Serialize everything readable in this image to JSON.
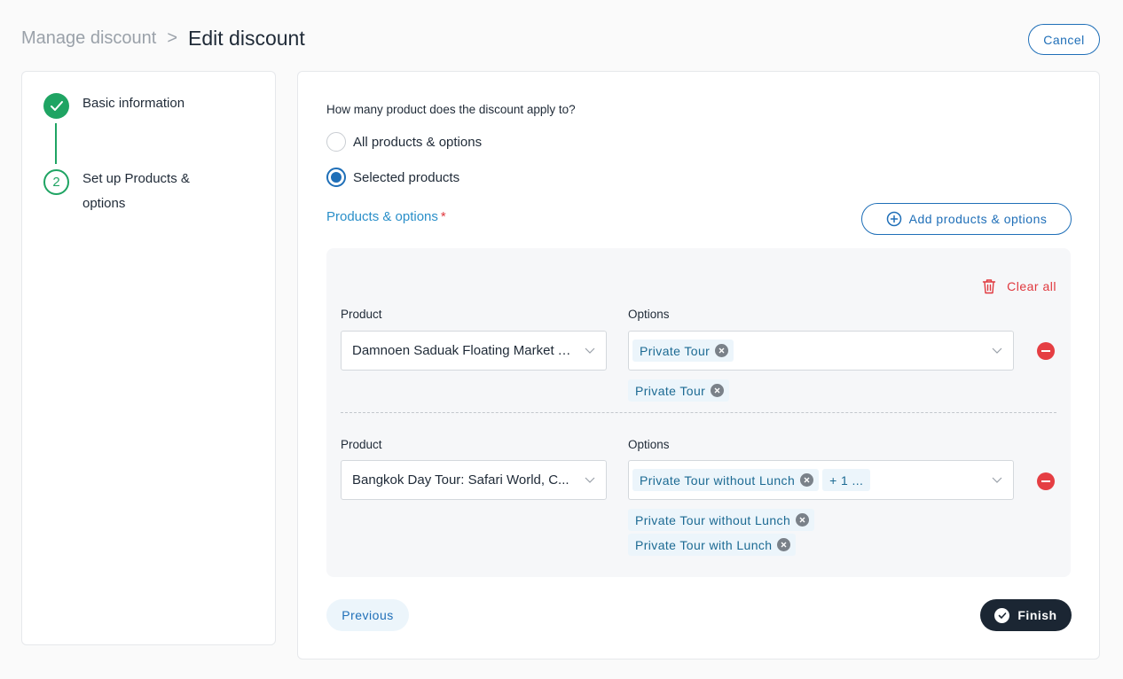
{
  "header": {
    "breadcrumb_parent": "Manage discount",
    "breadcrumb_separator": ">",
    "page_title": "Edit discount",
    "cancel_label": "Cancel"
  },
  "stepper": {
    "steps": [
      {
        "label": "Basic information",
        "status": "done"
      },
      {
        "number": "2",
        "label": "Set up Products & options",
        "status": "current"
      }
    ]
  },
  "form": {
    "question": "How many product does the discount apply to?",
    "radio_options": [
      {
        "label": "All products & options",
        "checked": false
      },
      {
        "label": "Selected products",
        "checked": true
      }
    ],
    "section_label": "Products & options",
    "required_mark": "*",
    "add_button_label": "Add products & options",
    "clear_all_label": "Clear all",
    "rows": [
      {
        "product_label": "Product",
        "options_label": "Options",
        "product_value": "Damnoen Saduak Floating Market Tour",
        "selected_tags": [
          "Private Tour"
        ],
        "more_tag": "",
        "all_options": [
          "Private Tour"
        ]
      },
      {
        "product_label": "Product",
        "options_label": "Options",
        "product_value": "Bangkok Day Tour: Safari World, C...",
        "selected_tags": [
          "Private Tour without Lunch"
        ],
        "more_tag": "+ 1 ...",
        "all_options": [
          "Private Tour without Lunch",
          "Private Tour with Lunch"
        ]
      }
    ]
  },
  "footer": {
    "previous_label": "Previous",
    "finish_label": "Finish"
  },
  "colors": {
    "accent_blue": "#1f6fb8",
    "success_green": "#1fa463",
    "danger_red": "#e53e43",
    "dark": "#1b2633"
  }
}
